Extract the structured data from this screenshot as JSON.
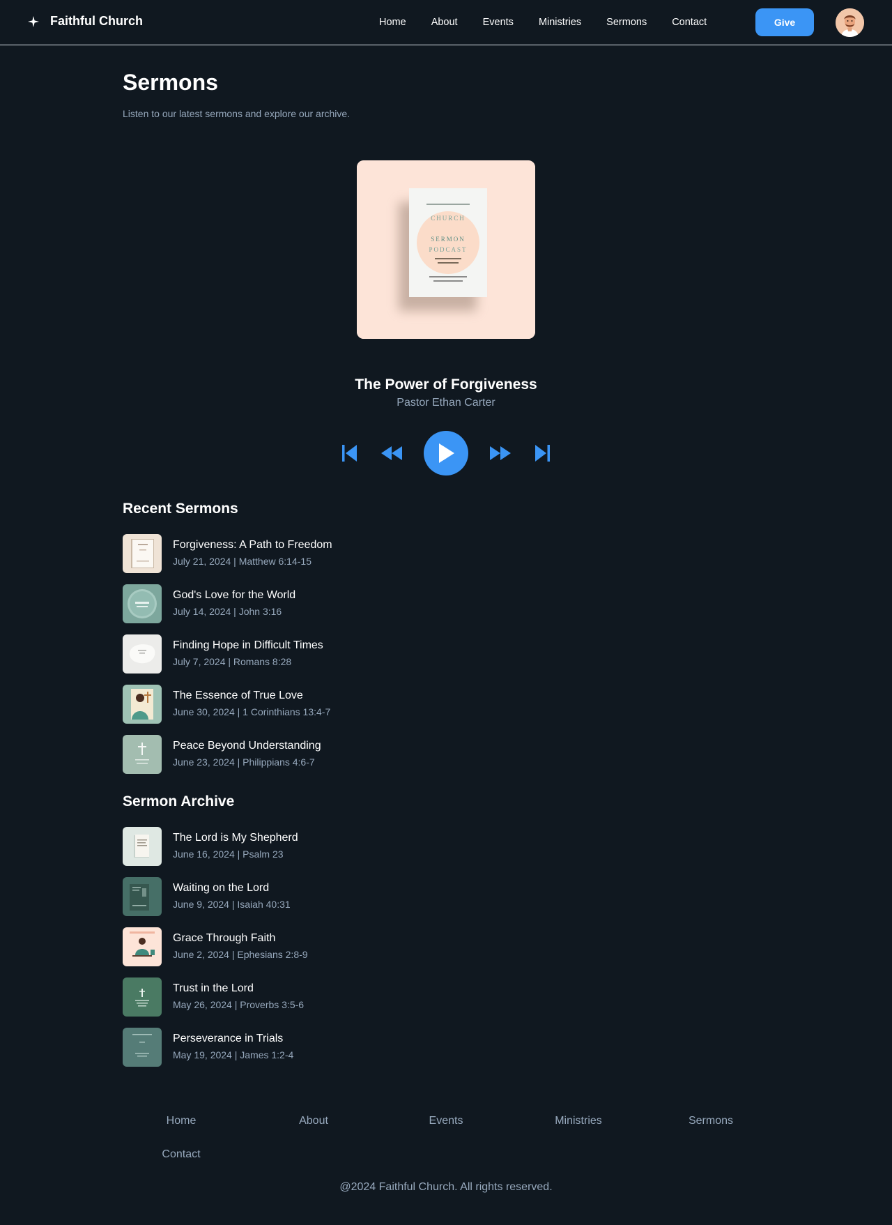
{
  "brand": {
    "name": "Faithful Church",
    "icon": "sparkle-icon"
  },
  "nav": [
    "Home",
    "About",
    "Events",
    "Ministries",
    "Sermons",
    "Contact"
  ],
  "header": {
    "give_label": "Give"
  },
  "page": {
    "title": "Sermons",
    "subtitle": "Listen to our latest sermons and explore our archive."
  },
  "now_playing": {
    "title": "The Power of Forgiveness",
    "speaker": "Pastor Ethan Carter",
    "cover_lines": [
      "CHURCH",
      "SERMON",
      "PODCAST"
    ]
  },
  "player": {
    "controls": [
      "skip-previous-icon",
      "rewind-icon",
      "play-icon",
      "fast-forward-icon",
      "skip-next-icon"
    ],
    "accent": "#3b95f5"
  },
  "recent": {
    "title": "Recent Sermons",
    "items": [
      {
        "title": "Forgiveness: A Path to Freedom",
        "meta": "July 21, 2024 | Matthew 6:14-15"
      },
      {
        "title": "God's Love for the World",
        "meta": "July 14, 2024 | John 3:16"
      },
      {
        "title": "Finding Hope in Difficult Times",
        "meta": "July 7, 2024 | Romans 8:28"
      },
      {
        "title": "The Essence of True Love",
        "meta": "June 30, 2024 | 1 Corinthians 13:4-7"
      },
      {
        "title": "Peace Beyond Understanding",
        "meta": "June 23, 2024 | Philippians 4:6-7"
      }
    ]
  },
  "archive": {
    "title": "Sermon Archive",
    "items": [
      {
        "title": "The Lord is My Shepherd",
        "meta": "June 16, 2024 | Psalm 23"
      },
      {
        "title": "Waiting on the Lord",
        "meta": "June 9, 2024 | Isaiah 40:31"
      },
      {
        "title": "Grace Through Faith",
        "meta": "June 2, 2024 | Ephesians 2:8-9"
      },
      {
        "title": "Trust in the Lord",
        "meta": "May 26, 2024 | Proverbs 3:5-6"
      },
      {
        "title": "Perseverance in Trials",
        "meta": "May 19, 2024 | James 1:2-4"
      }
    ]
  },
  "footer": {
    "links": [
      "Home",
      "About",
      "Events",
      "Ministries",
      "Sermons",
      "Contact"
    ],
    "copyright": "@2024 Faithful Church. All rights reserved."
  },
  "colors": {
    "background": "#101820",
    "accent": "#3b95f5",
    "muted_text": "#97a9bd",
    "cover_background": "#fde4d8"
  }
}
